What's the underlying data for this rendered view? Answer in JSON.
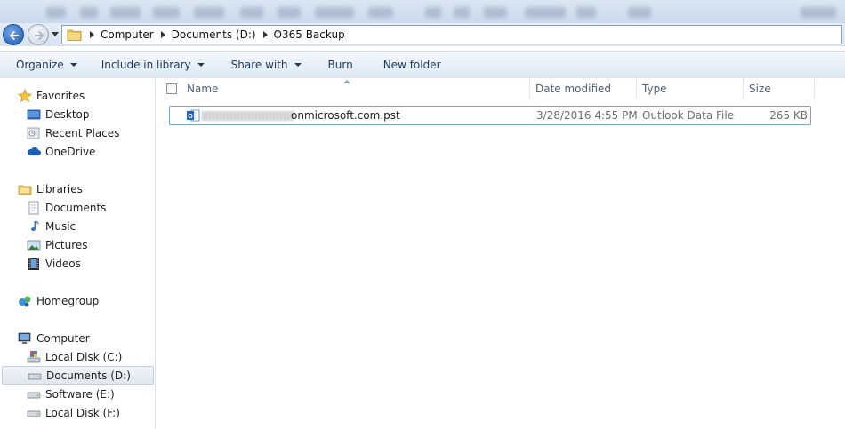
{
  "window": {
    "menu_strip_blurred": true
  },
  "address": {
    "crumbs": [
      "Computer",
      "Documents (D:)",
      "O365 Backup"
    ]
  },
  "toolbar": {
    "organize": "Organize",
    "include_in_library": "Include in library",
    "share_with": "Share with",
    "burn": "Burn",
    "new_folder": "New folder"
  },
  "navpane": {
    "favorites": "Favorites",
    "desktop": "Desktop",
    "recent_places": "Recent Places",
    "onedrive": "OneDrive",
    "libraries": "Libraries",
    "documents": "Documents",
    "music": "Music",
    "pictures": "Pictures",
    "videos": "Videos",
    "homegroup": "Homegroup",
    "computer": "Computer",
    "local_c": "Local Disk (C:)",
    "documents_d": "Documents (D:)",
    "software_e": "Software (E:)",
    "local_f": "Local Disk (F:)"
  },
  "columns": {
    "name": "Name",
    "date_modified": "Date modified",
    "type": "Type",
    "size": "Size"
  },
  "files": [
    {
      "name_visible": "onmicrosoft.com.pst",
      "date_modified": "3/28/2016 4:55 PM",
      "type": "Outlook Data File",
      "size": "265 KB",
      "icon": "outlook-pst-icon"
    }
  ],
  "colors": {
    "accent": "#1e395b",
    "selection_border": "#7da2ce",
    "header_text": "#4c607a"
  }
}
